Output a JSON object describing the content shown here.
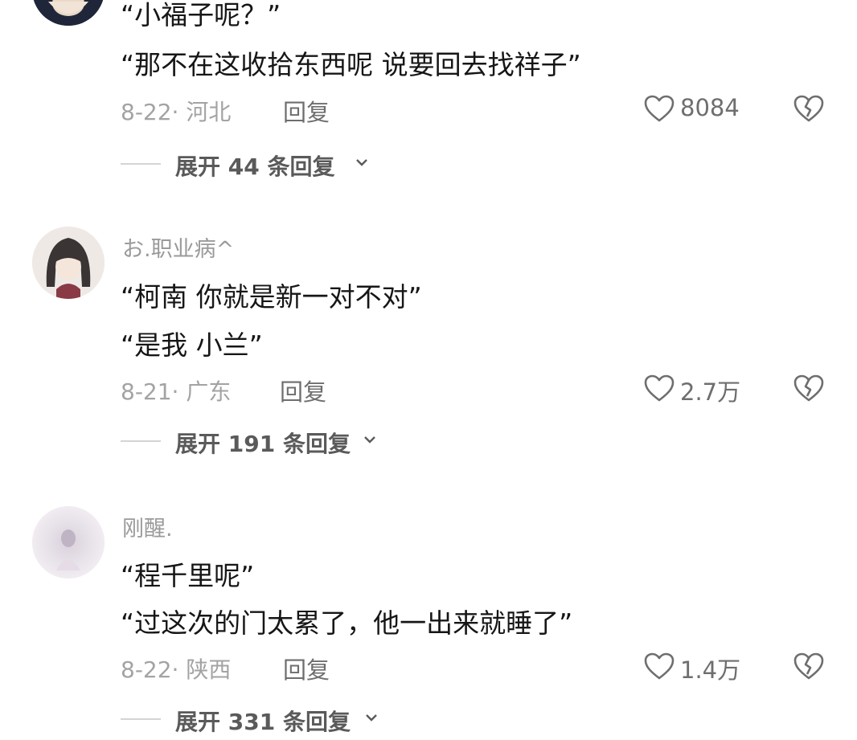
{
  "comments": [
    {
      "username": "",
      "lines": [
        "“小福子呢？”",
        "“那不在这收拾东西呢 说要回去找祥子”"
      ],
      "date": "8-22",
      "location": "河北",
      "reply_label": "回复",
      "likes": "8084",
      "expand_label": "展开 44 条回复",
      "avatar_icon": "user-avatar-dark"
    },
    {
      "username": "お.职业病^",
      "lines": [
        "“柯南 你就是新一对不对”",
        "“是我 小兰”"
      ],
      "date": "8-21",
      "location": "广东",
      "reply_label": "回复",
      "likes": "2.7万",
      "expand_label": "展开 191 条回复",
      "avatar_icon": "anime-girl-avatar"
    },
    {
      "username": "刚醒.",
      "lines": [
        "“程千里呢”",
        "“过这次的门太累了，他一出来就睡了”"
      ],
      "date": "8-22",
      "location": "陕西",
      "reply_label": "回复",
      "likes": "1.4万",
      "expand_label": "展开 331 条回复",
      "avatar_icon": "faded-photo-avatar"
    }
  ],
  "icons": {
    "like": "heart-outline-icon",
    "dislike": "broken-heart-icon",
    "expand": "chevron-down-icon"
  },
  "colors": {
    "text": "#161616",
    "muted": "#a3a3a3",
    "action": "#6e6e6e"
  }
}
